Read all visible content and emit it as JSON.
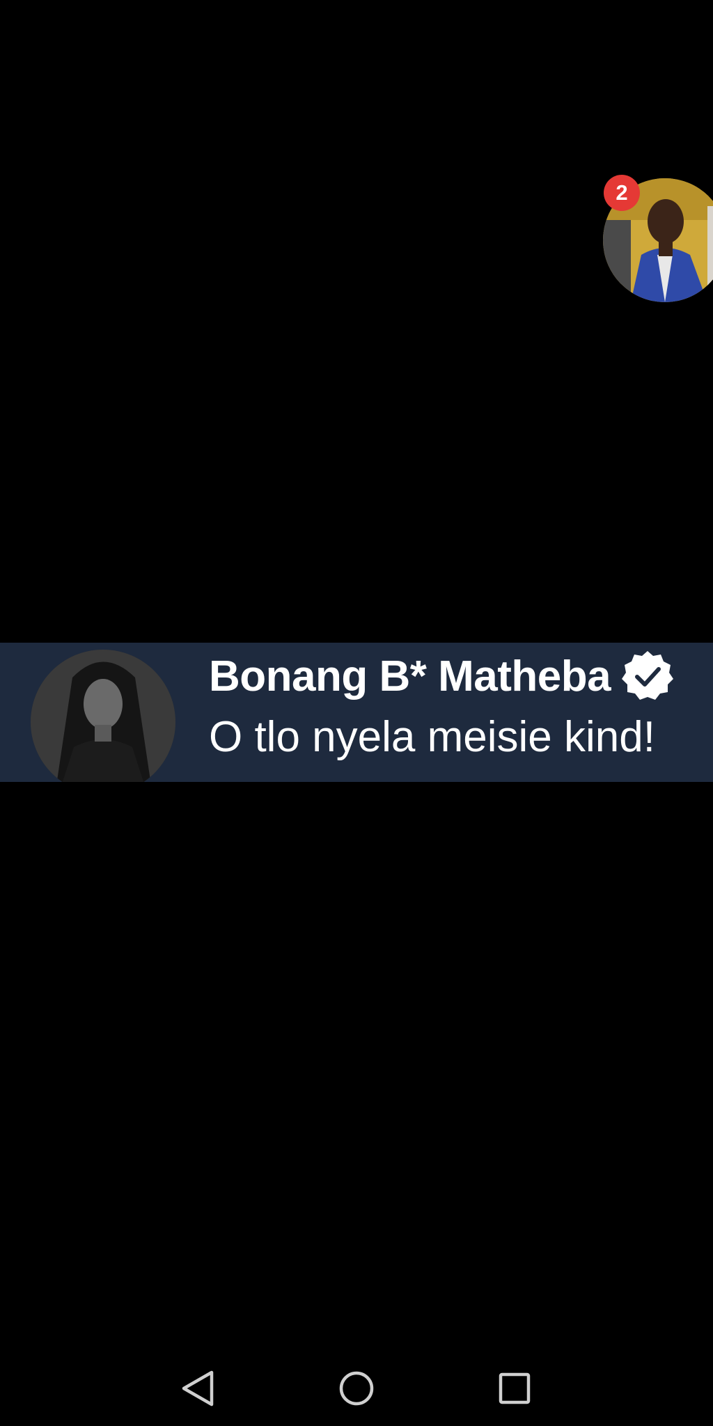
{
  "chat_head": {
    "badge_count": "2",
    "badge_color": "#e53935",
    "icon": "profile-photo"
  },
  "comment": {
    "author": "Bonang B* Matheba",
    "text": "O tlo nyela meisie kind!",
    "verified": true,
    "verified_icon": "verified-badge-icon",
    "banner_color": "#1e2a3e",
    "avatar_icon": "profile-photo"
  },
  "nav_bar": {
    "back_icon": "back-triangle-icon",
    "home_icon": "home-circle-icon",
    "recents_icon": "recents-square-icon",
    "icon_color": "#d0d0d0"
  }
}
